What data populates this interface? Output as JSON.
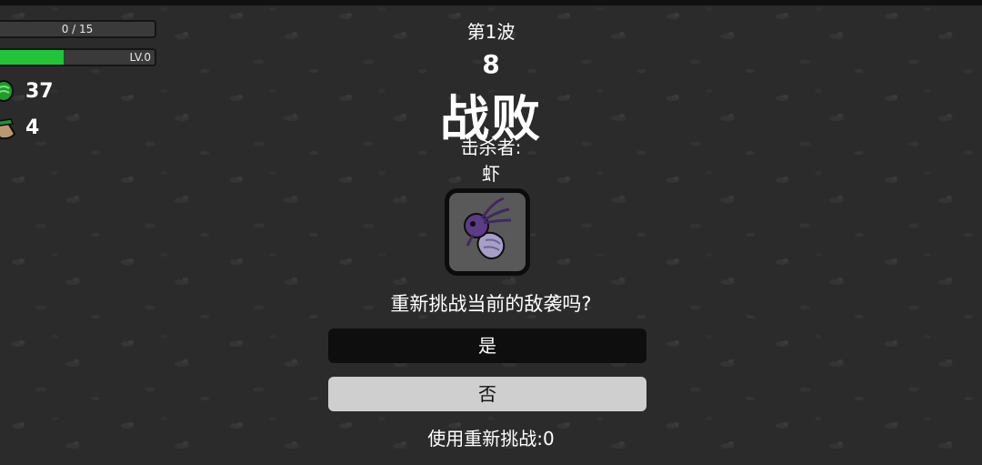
{
  "hud": {
    "hp_text": "0 / 15",
    "level_text": "LV.0",
    "xp_progress": 0.41,
    "materials_icon": "green-material-icon",
    "materials_count": "37",
    "bag_icon": "loot-bag-icon",
    "bag_count": "4"
  },
  "wave": {
    "label": "第1波",
    "timer": "8"
  },
  "result": {
    "title": "战败",
    "killer_label": "击杀者:",
    "killer_name": "虾",
    "killer_icon": "shrimp-enemy-icon"
  },
  "prompt": {
    "question": "重新挑战当前的敌袭吗?",
    "yes_label": "是",
    "no_label": "否",
    "retries_text": "使用重新挑战:0"
  },
  "colors": {
    "background": "#2a2a2a",
    "xp_fill": "#25c33a",
    "yes_button": "#0e0e0e",
    "no_button": "#cfcfcf"
  }
}
